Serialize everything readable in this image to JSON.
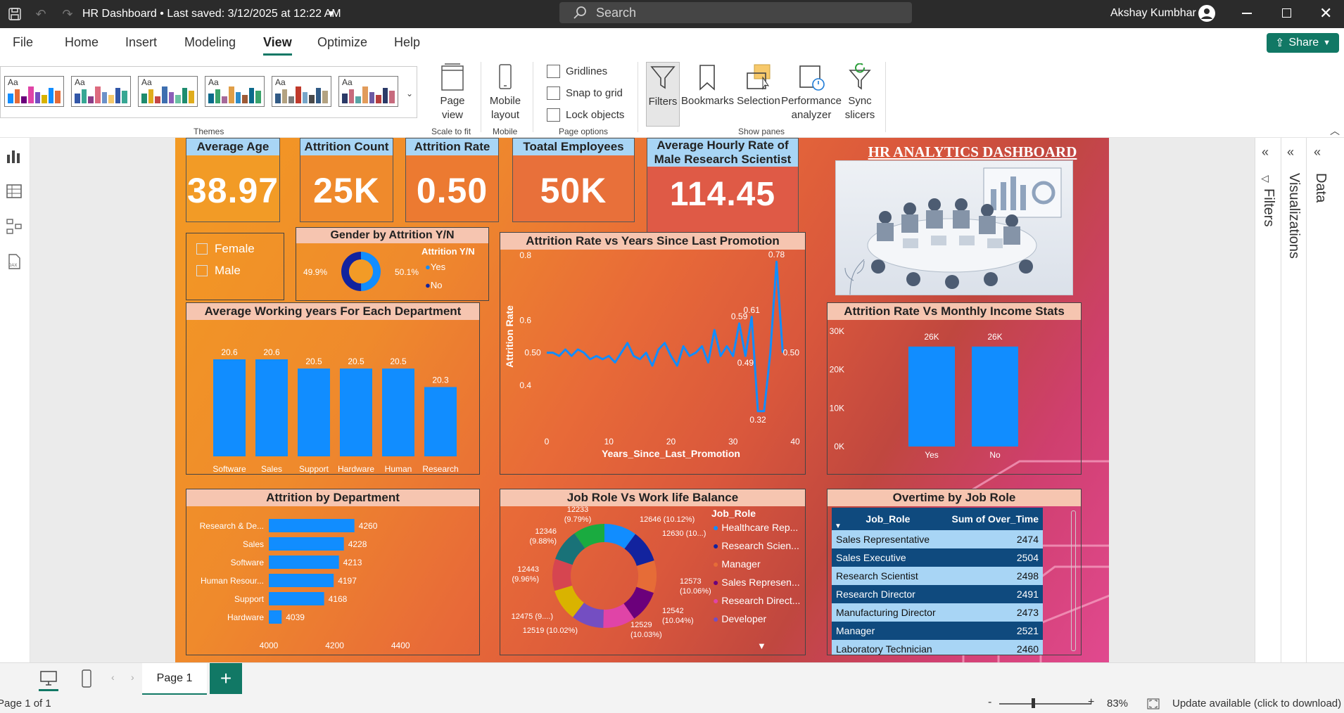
{
  "window": {
    "title": "HR Dashboard • Last saved: 3/12/2025 at 12:22 AM",
    "user": "Akshay Kumbhar"
  },
  "search": {
    "placeholder": "Search"
  },
  "menu": [
    "File",
    "Home",
    "Insert",
    "Modeling",
    "View",
    "Optimize",
    "Help"
  ],
  "share_label": "Share",
  "ribbon": {
    "themes_label": "Themes",
    "page_view": "Page view",
    "scale_to_fit": "Scale to fit",
    "mobile_layout": "Mobile layout",
    "mobile": "Mobile",
    "gridlines": "Gridlines",
    "snap": "Snap to grid",
    "lock": "Lock objects",
    "page_options": "Page options",
    "filters": "Filters",
    "bookmarks": "Bookmarks",
    "selection": "Selection",
    "perf": "Performance analyzer",
    "sync": "Sync slicers",
    "show_panes": "Show panes",
    "theme_colors": [
      [
        "#118dff",
        "#e66c37",
        "#6b007b",
        "#e044a7",
        "#744ec2",
        "#d9b300"
      ],
      [
        "#3257a8",
        "#37a794",
        "#8b3d88",
        "#dd6b7f",
        "#6b91c9",
        "#f5c869"
      ],
      [
        "#1e8c6e",
        "#e0ad1d",
        "#c54646",
        "#3e6fb0",
        "#8c5fb8",
        "#6ac2a3"
      ],
      [
        "#0b6a8b",
        "#39a36b",
        "#a66999",
        "#e09e47",
        "#2e8cc9",
        "#9d5a36"
      ],
      [
        "#315a85",
        "#b3a281",
        "#7a7a7a",
        "#c0392b",
        "#77a6c9",
        "#4a4a4a"
      ],
      [
        "#2b3a67",
        "#c76a7d",
        "#58a5a6",
        "#e29c5b",
        "#6d5aa3",
        "#b73e3e"
      ]
    ]
  },
  "kpis": [
    {
      "title": "Average Age",
      "value": "38.97"
    },
    {
      "title": "Attrition Count",
      "value": "25K"
    },
    {
      "title": "Attrition Rate",
      "value": "0.50"
    },
    {
      "title": "Toatal Employees",
      "value": "50K"
    },
    {
      "title": "Average Hourly Rate of Male Research Scientist",
      "value": "114.45"
    }
  ],
  "dashboard_title": "HR ANALYTICS DASHBOARD",
  "slicer": {
    "options": [
      "Female",
      "Male"
    ]
  },
  "gender_chart": {
    "title": "Gender by Attrition Y/N",
    "legend_title": "Attrition Y/N",
    "legend": [
      "Yes",
      "No"
    ],
    "labels": [
      "49.9%",
      "50.1%"
    ]
  },
  "dept_years": {
    "title": "Average Working years For Each Department"
  },
  "promo_chart": {
    "title": "Attrition Rate vs Years Since Last Promotion",
    "xlabel": "Years_Since_Last_Promotion",
    "ylabel": "Attrition Rate"
  },
  "income_chart": {
    "title": "Attrition Rate Vs Monthly Income Stats"
  },
  "attr_dept": {
    "title": "Attrition by Department"
  },
  "jobrole": {
    "title": "Job Role Vs Work life Balance",
    "legend_title": "Job_Role",
    "legend": [
      "Healthcare Rep...",
      "Research Scien...",
      "Manager",
      "Sales Represen...",
      "Research Direct...",
      "Developer"
    ],
    "labels": [
      "12233 (9.79%)",
      "12646 (10.12%)",
      "12630 (10...)",
      "12573 (10.06%)",
      "12542 (10.04%)",
      "12529 (10.03%)",
      "12519 (10.02%)",
      "12475 (9....)",
      "12443 (9.96%)",
      "12346 (9.88%)"
    ]
  },
  "overtime": {
    "title": "Overtime by Job Role",
    "col1": "Job_Role",
    "col2": "Sum of Over_Time",
    "rows": [
      [
        "Sales Representative",
        "2474"
      ],
      [
        "Sales Executive",
        "2504"
      ],
      [
        "Research Scientist",
        "2498"
      ],
      [
        "Research Director",
        "2491"
      ],
      [
        "Manufacturing Director",
        "2473"
      ],
      [
        "Manager",
        "2521"
      ],
      [
        "Laboratory Technician",
        "2460"
      ]
    ]
  },
  "panes": {
    "filters": "Filters",
    "visualizations": "Visualizations",
    "data": "Data"
  },
  "tabs": {
    "page1": "Page 1"
  },
  "status": {
    "page": "Page 1 of 1",
    "zoom": "83%",
    "update": "Update available (click to download)"
  },
  "chart_data": [
    {
      "type": "bar",
      "title": "Average Working years For Each Department",
      "categories": [
        "Software",
        "Sales",
        "Support",
        "Hardware",
        "Human Resourc...",
        "Research & Develo..."
      ],
      "values": [
        20.6,
        20.6,
        20.5,
        20.5,
        20.5,
        20.3
      ]
    },
    {
      "type": "line",
      "title": "Attrition Rate vs Years Since Last Promotion",
      "xlabel": "Years_Since_Last_Promotion",
      "ylabel": "Attrition Rate",
      "xlim": [
        0,
        40
      ],
      "ylim": [
        0.3,
        0.8
      ],
      "xticks": [
        0,
        10,
        20,
        30,
        40
      ],
      "yticks": [
        0.4,
        0.6,
        0.8
      ],
      "x": [
        0,
        1,
        2,
        3,
        4,
        5,
        6,
        7,
        8,
        9,
        10,
        11,
        12,
        13,
        14,
        15,
        16,
        17,
        18,
        19,
        20,
        21,
        22,
        23,
        24,
        25,
        26,
        27,
        28,
        29,
        30,
        31,
        32,
        33,
        34,
        35,
        36,
        37,
        38
      ],
      "y": [
        0.5,
        0.5,
        0.49,
        0.51,
        0.49,
        0.51,
        0.5,
        0.48,
        0.49,
        0.48,
        0.49,
        0.47,
        0.5,
        0.53,
        0.49,
        0.48,
        0.5,
        0.46,
        0.51,
        0.53,
        0.49,
        0.46,
        0.52,
        0.49,
        0.5,
        0.52,
        0.47,
        0.57,
        0.49,
        0.52,
        0.49,
        0.59,
        0.49,
        0.61,
        0.32,
        0.32,
        0.5,
        0.78,
        0.5
      ],
      "labels": [
        {
          "x": 0,
          "y": 0.5,
          "text": "0.50"
        },
        {
          "x": 31,
          "y": 0.59,
          "text": "0.59"
        },
        {
          "x": 32,
          "y": 0.49,
          "text": "0.49"
        },
        {
          "x": 33,
          "y": 0.61,
          "text": "0.61"
        },
        {
          "x": 34,
          "y": 0.32,
          "text": "0.32"
        },
        {
          "x": 37,
          "y": 0.78,
          "text": "0.78"
        },
        {
          "x": 38,
          "y": 0.5,
          "text": "0.50"
        }
      ]
    },
    {
      "type": "bar",
      "title": "Attrition Rate Vs Monthly Income Stats",
      "categories": [
        "Yes",
        "No"
      ],
      "values": [
        26000,
        26000
      ],
      "value_labels": [
        "26K",
        "26K"
      ],
      "ylim": [
        0,
        30000
      ],
      "yticks": [
        "0K",
        "10K",
        "20K",
        "30K"
      ]
    },
    {
      "type": "bar",
      "title": "Attrition by Department",
      "orientation": "horizontal",
      "categories": [
        "Research & De...",
        "Sales",
        "Software",
        "Human Resour...",
        "Support",
        "Hardware"
      ],
      "values": [
        4260,
        4228,
        4213,
        4197,
        4168,
        4039
      ],
      "xlim": [
        4000,
        4500
      ],
      "xticks": [
        4000,
        4200,
        4400
      ]
    },
    {
      "type": "pie",
      "title": "Gender by Attrition Y/N",
      "categories": [
        "Yes",
        "No"
      ],
      "values": [
        49.9,
        50.1
      ]
    },
    {
      "type": "pie",
      "title": "Job Role Vs Work life Balance",
      "values": [
        12646,
        12630,
        12573,
        12542,
        12529,
        12519,
        12475,
        12443,
        12346,
        12233
      ],
      "colors": [
        "#118dff",
        "#12239e",
        "#e66c37",
        "#6b007b",
        "#e044a7",
        "#744ec2",
        "#d9b300",
        "#d64550",
        "#197278",
        "#1aab40"
      ]
    }
  ]
}
